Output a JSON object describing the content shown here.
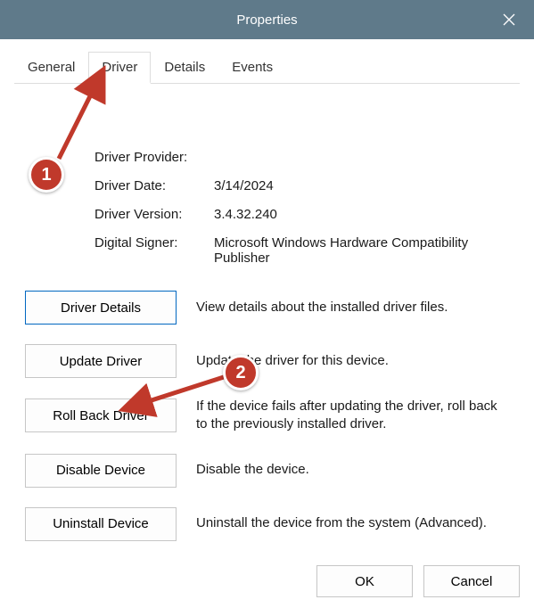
{
  "window": {
    "title": "Properties"
  },
  "tabs": {
    "general": "General",
    "driver": "Driver",
    "details": "Details",
    "events": "Events",
    "active": "Driver"
  },
  "driver_info": {
    "provider_label": "Driver Provider:",
    "provider_value": "",
    "date_label": "Driver Date:",
    "date_value": "3/14/2024",
    "version_label": "Driver Version:",
    "version_value": "3.4.32.240",
    "signer_label": "Digital Signer:",
    "signer_value": "Microsoft Windows Hardware Compatibility Publisher"
  },
  "actions": {
    "details": {
      "label": "Driver Details",
      "desc": "View details about the installed driver files."
    },
    "update": {
      "label": "Update Driver",
      "desc": "Update the driver for this device."
    },
    "rollback": {
      "label": "Roll Back Driver",
      "desc": "If the device fails after updating the driver, roll back to the previously installed driver."
    },
    "disable": {
      "label": "Disable Device",
      "desc": "Disable the device."
    },
    "uninstall": {
      "label": "Uninstall Device",
      "desc": "Uninstall the device from the system (Advanced)."
    }
  },
  "footer": {
    "ok": "OK",
    "cancel": "Cancel"
  },
  "annotations": {
    "badge1": "1",
    "badge2": "2"
  }
}
